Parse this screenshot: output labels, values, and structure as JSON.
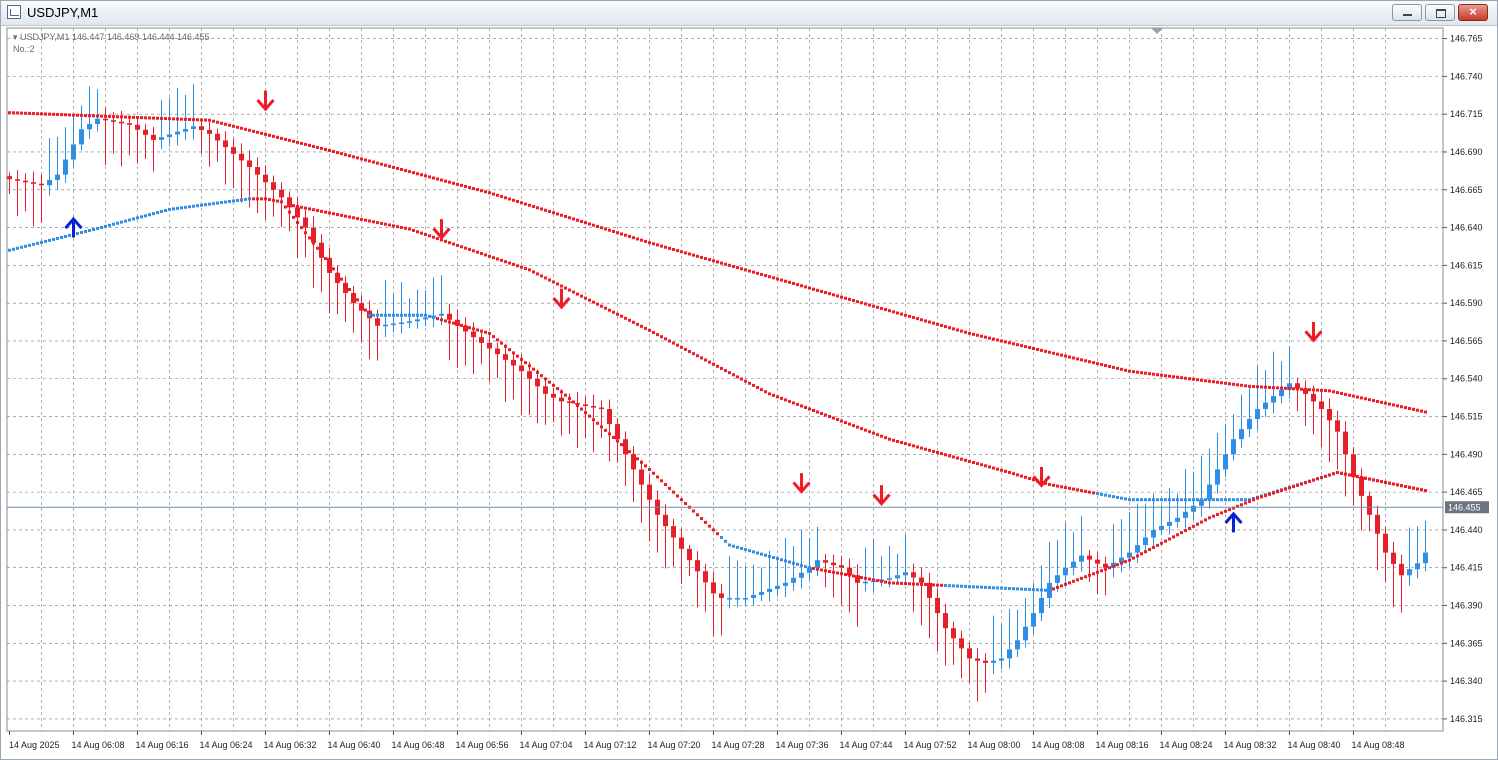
{
  "window": {
    "title": "USDJPY,M1",
    "min_icon": "minimize-icon",
    "max_icon": "maximize-icon",
    "close_icon": "close-icon",
    "close_glyph": "×"
  },
  "chart_data": {
    "type": "candlestick",
    "symbol_info": "▾ USDJPY,M1  146.447 146.469 146.444 146.455",
    "indicator_label": "No.:2",
    "current_price": 146.455,
    "current_price_label": "146.455",
    "ylim": [
      146.307,
      146.772
    ],
    "yticks": [
      "146.765",
      "146.740",
      "146.715",
      "146.690",
      "146.665",
      "146.640",
      "146.615",
      "146.590",
      "146.565",
      "146.540",
      "146.515",
      "146.490",
      "146.465",
      "146.440",
      "146.415",
      "146.390",
      "146.365",
      "146.340",
      "146.315"
    ],
    "xticks": [
      "14 Aug 2025",
      "14 Aug 06:08",
      "14 Aug 06:16",
      "14 Aug 06:24",
      "14 Aug 06:32",
      "14 Aug 06:40",
      "14 Aug 06:48",
      "14 Aug 06:56",
      "14 Aug 07:04",
      "14 Aug 07:12",
      "14 Aug 07:20",
      "14 Aug 07:28",
      "14 Aug 07:36",
      "14 Aug 07:44",
      "14 Aug 07:52",
      "14 Aug 08:00",
      "14 Aug 08:08",
      "14 Aug 08:16",
      "14 Aug 08:24",
      "14 Aug 08:32",
      "14 Aug 08:40",
      "14 Aug 08:48"
    ],
    "close_keypoints": [
      [
        0,
        146.672
      ],
      [
        4,
        146.668
      ],
      [
        6,
        146.675
      ],
      [
        9,
        146.705
      ],
      [
        11,
        146.712
      ],
      [
        15,
        146.708
      ],
      [
        18,
        146.698
      ],
      [
        23,
        146.707
      ],
      [
        25,
        146.702
      ],
      [
        30,
        146.68
      ],
      [
        34,
        146.66
      ],
      [
        37,
        146.64
      ],
      [
        40,
        146.61
      ],
      [
        43,
        146.59
      ],
      [
        46,
        146.575
      ],
      [
        50,
        146.578
      ],
      [
        54,
        146.583
      ],
      [
        56,
        146.575
      ],
      [
        60,
        146.56
      ],
      [
        64,
        146.545
      ],
      [
        67,
        146.53
      ],
      [
        69,
        146.525
      ],
      [
        74,
        146.52
      ],
      [
        75,
        146.51
      ],
      [
        77,
        146.49
      ],
      [
        81,
        146.45
      ],
      [
        85,
        146.42
      ],
      [
        88,
        146.398
      ],
      [
        89,
        146.395
      ],
      [
        92,
        146.395
      ],
      [
        97,
        146.405
      ],
      [
        100,
        146.415
      ],
      [
        101,
        146.42
      ],
      [
        104,
        146.415
      ],
      [
        106,
        146.405
      ],
      [
        110,
        146.408
      ],
      [
        112,
        146.412
      ],
      [
        114,
        146.405
      ],
      [
        117,
        146.375
      ],
      [
        120,
        146.355
      ],
      [
        122,
        146.352
      ],
      [
        124,
        146.355
      ],
      [
        126,
        146.367
      ],
      [
        128,
        146.385
      ],
      [
        130,
        146.405
      ],
      [
        132,
        146.415
      ],
      [
        134,
        146.423
      ],
      [
        137,
        146.415
      ],
      [
        140,
        146.425
      ],
      [
        143,
        146.44
      ],
      [
        146,
        146.448
      ],
      [
        149,
        146.46
      ],
      [
        151,
        146.48
      ],
      [
        153,
        146.5
      ],
      [
        156,
        146.52
      ],
      [
        160,
        146.537
      ],
      [
        162,
        146.53
      ],
      [
        164,
        146.52
      ],
      [
        166,
        146.505
      ],
      [
        168,
        146.475
      ],
      [
        170,
        146.45
      ],
      [
        172,
        146.425
      ],
      [
        174,
        146.41
      ],
      [
        176,
        146.418
      ],
      [
        177,
        146.425
      ]
    ],
    "ma_slow": [
      [
        0,
        146.716
      ],
      [
        25,
        146.711
      ],
      [
        40,
        146.691
      ],
      [
        60,
        146.663
      ],
      [
        80,
        146.63
      ],
      [
        100,
        146.6
      ],
      [
        120,
        146.57
      ],
      [
        140,
        146.545
      ],
      [
        155,
        146.535
      ],
      [
        165,
        146.532
      ],
      [
        177,
        146.518
      ]
    ],
    "ma_mid": [
      [
        35,
        146.655
      ],
      [
        50,
        146.639
      ],
      [
        65,
        146.612
      ],
      [
        80,
        146.572
      ],
      [
        95,
        146.53
      ],
      [
        110,
        146.5
      ],
      [
        125,
        146.478
      ],
      [
        130,
        146.47
      ],
      [
        140,
        146.46
      ],
      [
        155,
        146.46
      ],
      [
        166,
        146.478
      ],
      [
        177,
        146.466
      ]
    ],
    "ma_short": [
      [
        0,
        146.625
      ],
      [
        10,
        146.638
      ],
      [
        20,
        146.652
      ],
      [
        30,
        146.659
      ],
      [
        32,
        146.659
      ],
      [
        34,
        146.657
      ],
      [
        45,
        146.582
      ],
      [
        52,
        146.582
      ],
      [
        60,
        146.57
      ],
      [
        70,
        146.527
      ],
      [
        80,
        146.48
      ],
      [
        90,
        146.43
      ],
      [
        100,
        146.415
      ],
      [
        110,
        146.405
      ],
      [
        130,
        146.4
      ],
      [
        140,
        146.42
      ],
      [
        150,
        146.448
      ],
      [
        156,
        146.461
      ],
      [
        166,
        146.478
      ],
      [
        177,
        146.466
      ]
    ],
    "trend_segments": [
      {
        "line": "ma_short",
        "from": 0,
        "to": 30,
        "dir": "up"
      },
      {
        "line": "ma_mid",
        "from": 35,
        "to": 45,
        "dir": "down"
      },
      {
        "line": "ma_short",
        "from": 45,
        "to": 53,
        "dir": "up"
      },
      {
        "line": "ma_short",
        "from": 53,
        "to": 89,
        "dir": "down"
      },
      {
        "line": "ma_short",
        "from": 89,
        "to": 100,
        "dir": "up"
      },
      {
        "line": "ma_short",
        "from": 100,
        "to": 117,
        "dir": "down"
      },
      {
        "line": "ma_short",
        "from": 117,
        "to": 130,
        "dir": "up"
      },
      {
        "line": "ma_mid",
        "from": 128,
        "to": 136,
        "dir": "down"
      },
      {
        "line": "ma_mid",
        "from": 136,
        "to": 166,
        "dir": "up"
      },
      {
        "line": "ma_mid",
        "from": 166,
        "to": 177,
        "dir": "down"
      }
    ],
    "arrows": [
      {
        "bar": 8,
        "price": 146.641,
        "dir": "up"
      },
      {
        "bar": 32,
        "price": 146.723,
        "dir": "down"
      },
      {
        "bar": 54,
        "price": 146.638,
        "dir": "down"
      },
      {
        "bar": 69,
        "price": 146.592,
        "dir": "down"
      },
      {
        "bar": 99,
        "price": 146.47,
        "dir": "down"
      },
      {
        "bar": 109,
        "price": 146.462,
        "dir": "down"
      },
      {
        "bar": 129,
        "price": 146.474,
        "dir": "down"
      },
      {
        "bar": 153,
        "price": 146.446,
        "dir": "up"
      },
      {
        "bar": 163,
        "price": 146.57,
        "dir": "down"
      }
    ],
    "colors": {
      "up": "#2f8fe6",
      "down": "#e5202a",
      "ma": "#ee1c25",
      "ma_blue": "#2f8fe6",
      "arrow_down": "#ee1c25",
      "arrow_up": "#0b1fd6",
      "grid": "#7a7f86",
      "bid": "#6b90b0"
    },
    "grid": true
  }
}
